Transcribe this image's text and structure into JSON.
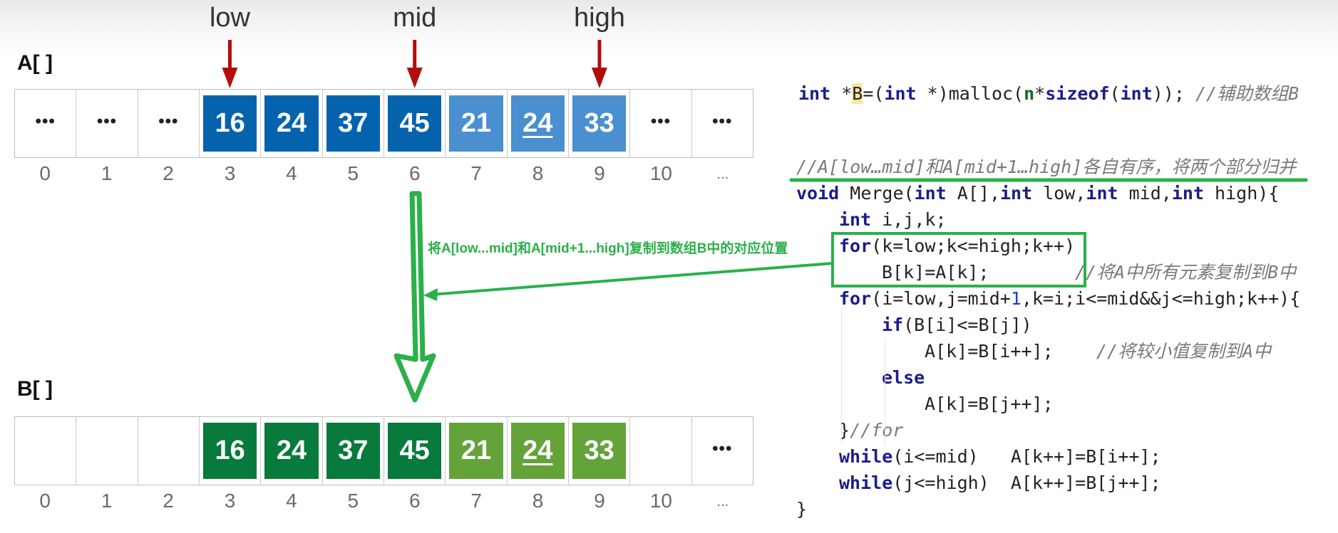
{
  "array_a": {
    "label": "A[ ]",
    "cells": [
      {
        "text": "...",
        "kind": "empty-dots"
      },
      {
        "text": "...",
        "kind": "empty-dots"
      },
      {
        "text": "...",
        "kind": "empty-dots"
      },
      {
        "text": "16",
        "kind": "left-half"
      },
      {
        "text": "24",
        "kind": "left-half"
      },
      {
        "text": "37",
        "kind": "left-half"
      },
      {
        "text": "45",
        "kind": "left-half"
      },
      {
        "text": "21",
        "kind": "right-half"
      },
      {
        "text": "24",
        "kind": "right-half",
        "underlined": true
      },
      {
        "text": "33",
        "kind": "right-half"
      },
      {
        "text": "...",
        "kind": "empty-dots"
      },
      {
        "text": "...",
        "kind": "empty-dots"
      }
    ],
    "indices": [
      "0",
      "1",
      "2",
      "3",
      "4",
      "5",
      "6",
      "7",
      "8",
      "9",
      "10",
      "..."
    ]
  },
  "array_b": {
    "label": "B[ ]",
    "cells": [
      {
        "text": "",
        "kind": "empty"
      },
      {
        "text": "",
        "kind": "empty"
      },
      {
        "text": "",
        "kind": "empty"
      },
      {
        "text": "16",
        "kind": "left-half"
      },
      {
        "text": "24",
        "kind": "left-half"
      },
      {
        "text": "37",
        "kind": "left-half"
      },
      {
        "text": "45",
        "kind": "left-half"
      },
      {
        "text": "21",
        "kind": "right-half"
      },
      {
        "text": "24",
        "kind": "right-half",
        "underlined": true
      },
      {
        "text": "33",
        "kind": "right-half"
      },
      {
        "text": "",
        "kind": "empty"
      },
      {
        "text": "...",
        "kind": "empty-dots"
      }
    ],
    "indices": [
      "0",
      "1",
      "2",
      "3",
      "4",
      "5",
      "6",
      "7",
      "8",
      "9",
      "10",
      "..."
    ]
  },
  "pointers": [
    {
      "label": "low",
      "index": 3
    },
    {
      "label": "mid",
      "index": 6
    },
    {
      "label": "high",
      "index": 9
    }
  ],
  "annotation": "将A[low...mid]和A[mid+1...high]复制到数组B中的对应位置",
  "colors": {
    "a_left": "#0563ad",
    "a_right": "#4a8fcf",
    "b_left": "#087a3c",
    "b_right": "#63a33a",
    "pointer_arrow": "#b30d0d",
    "annotation_green": "#2bb04a"
  },
  "code": {
    "malloc_line": [
      {
        "t": "int",
        "c": "kw"
      },
      {
        "t": " *"
      },
      {
        "t": "B",
        "c": "hl"
      },
      {
        "t": "=("
      },
      {
        "t": "int",
        "c": "kw"
      },
      {
        "t": " *)malloc("
      },
      {
        "t": "n",
        "c": "var"
      },
      {
        "t": "*"
      },
      {
        "t": "sizeof",
        "c": "kw"
      },
      {
        "t": "("
      },
      {
        "t": "int",
        "c": "kw"
      },
      {
        "t": ")); "
      },
      {
        "t": "//辅助数组B",
        "c": "cm"
      }
    ],
    "lines": [
      {
        "indent": 0,
        "parts": [
          {
            "t": "//A[low…mid]和A[mid+1…high]各自有序，将两个部分归并",
            "c": "cm"
          }
        ]
      },
      {
        "indent": 0,
        "parts": [
          {
            "t": "void",
            "c": "kw"
          },
          {
            "t": " Merge("
          },
          {
            "t": "int",
            "c": "kw"
          },
          {
            "t": " A[],"
          },
          {
            "t": "int",
            "c": "kw"
          },
          {
            "t": " low,"
          },
          {
            "t": "int",
            "c": "kw"
          },
          {
            "t": " mid,"
          },
          {
            "t": "int",
            "c": "kw"
          },
          {
            "t": " high){"
          }
        ]
      },
      {
        "indent": 1,
        "parts": [
          {
            "t": "int",
            "c": "kw"
          },
          {
            "t": " i,j,k;"
          }
        ]
      },
      {
        "indent": 1,
        "parts": [
          {
            "t": "for",
            "c": "kw"
          },
          {
            "t": "(k=low;k<=high;k++)"
          }
        ]
      },
      {
        "indent": 2,
        "parts": [
          {
            "t": "B[k]=A[k];"
          },
          {
            "t": "        "
          },
          {
            "t": "//将A中所有元素复制到B中",
            "c": "cm"
          }
        ]
      },
      {
        "indent": 1,
        "parts": [
          {
            "t": "for",
            "c": "kw"
          },
          {
            "t": "(i=low,j=mid+"
          },
          {
            "t": "1",
            "c": "num"
          },
          {
            "t": ",k=i;i<=mid&&j<=high;k++){"
          }
        ]
      },
      {
        "indent": 2,
        "parts": [
          {
            "t": "if",
            "c": "kw"
          },
          {
            "t": "(B[i]<=B[j])"
          }
        ]
      },
      {
        "indent": 3,
        "parts": [
          {
            "t": "A[k]=B[i++];"
          },
          {
            "t": "    "
          },
          {
            "t": "//将较小值复制到A中",
            "c": "cm"
          }
        ]
      },
      {
        "indent": 2,
        "parts": [
          {
            "t": "else",
            "c": "kw"
          }
        ]
      },
      {
        "indent": 3,
        "parts": [
          {
            "t": "A[k]=B[j++];"
          }
        ]
      },
      {
        "indent": 1,
        "parts": [
          {
            "t": "}"
          },
          {
            "t": "//for",
            "c": "cm"
          }
        ]
      },
      {
        "indent": 1,
        "parts": [
          {
            "t": "while",
            "c": "kw"
          },
          {
            "t": "(i<=mid)   A[k++]=B[i++];"
          }
        ]
      },
      {
        "indent": 1,
        "parts": [
          {
            "t": "while",
            "c": "kw"
          },
          {
            "t": "(j<=high)  A[k++]=B[j++];"
          }
        ]
      },
      {
        "indent": 0,
        "parts": [
          {
            "t": "}"
          }
        ]
      }
    ]
  }
}
